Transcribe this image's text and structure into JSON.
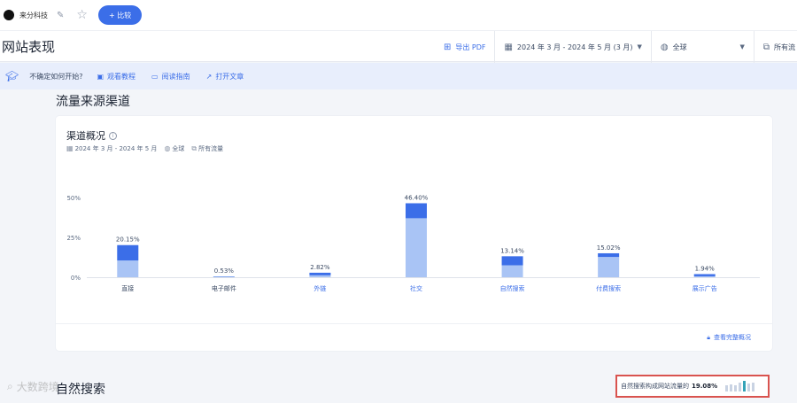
{
  "topbar": {
    "site_name": "来分科技",
    "compare_label": "+ 比较"
  },
  "header": {
    "title": "网站表现",
    "export_label": "导出 PDF",
    "date_range": "2024 年 3 月 - 2024 年 5 月 (3 月)",
    "region": "全球",
    "traffic": "所有流"
  },
  "helpbar": {
    "question": "不确定如何开始?",
    "links": [
      "观看教程",
      "阅读指南",
      "打开文章"
    ]
  },
  "section": {
    "title": "流量来源渠道",
    "next_title": "自然搜索"
  },
  "card": {
    "title": "渠道概况",
    "meta_date": "2024 年 3 月 - 2024 年 5 月",
    "meta_region": "全球",
    "meta_traffic": "所有流量",
    "full_link": "查看完整概况"
  },
  "callout": {
    "text": "自然搜索构成网站流量的",
    "value": "19.08%",
    "spark_levels": [
      0.55,
      0.7,
      0.6,
      0.85,
      1.0,
      0.75,
      0.8
    ],
    "spark_highlight": [
      4
    ]
  },
  "watermark": "大数跨境",
  "colors": {
    "accent": "#3b6ee8",
    "bar_dark": "#3b6ee8",
    "bar_light": "#a9c4f5",
    "callout_border": "#d9534f"
  },
  "chart_data": {
    "type": "bar",
    "categories": [
      "直接",
      "电子邮件",
      "外链",
      "社交",
      "自然搜索",
      "付费搜索",
      "展示广告"
    ],
    "values": [
      20.15,
      0.53,
      2.82,
      46.4,
      13.14,
      15.02,
      1.94
    ],
    "value_labels": [
      "20.15%",
      "0.53%",
      "2.82%",
      "46.40%",
      "13.14%",
      "15.02%",
      "1.94%"
    ],
    "series_split": {
      "light": [
        10.5,
        0.3,
        1.2,
        37.0,
        7.5,
        12.7,
        0.6
      ],
      "dark": [
        9.65,
        0.23,
        1.62,
        9.4,
        5.64,
        2.32,
        1.34
      ]
    },
    "ylim": [
      0,
      50
    ],
    "yticks": [
      "0%",
      "25%",
      "50%"
    ],
    "ytick_values": [
      0,
      25,
      50
    ],
    "link_categories": [
      2,
      3,
      4,
      5,
      6
    ],
    "grid": false
  }
}
